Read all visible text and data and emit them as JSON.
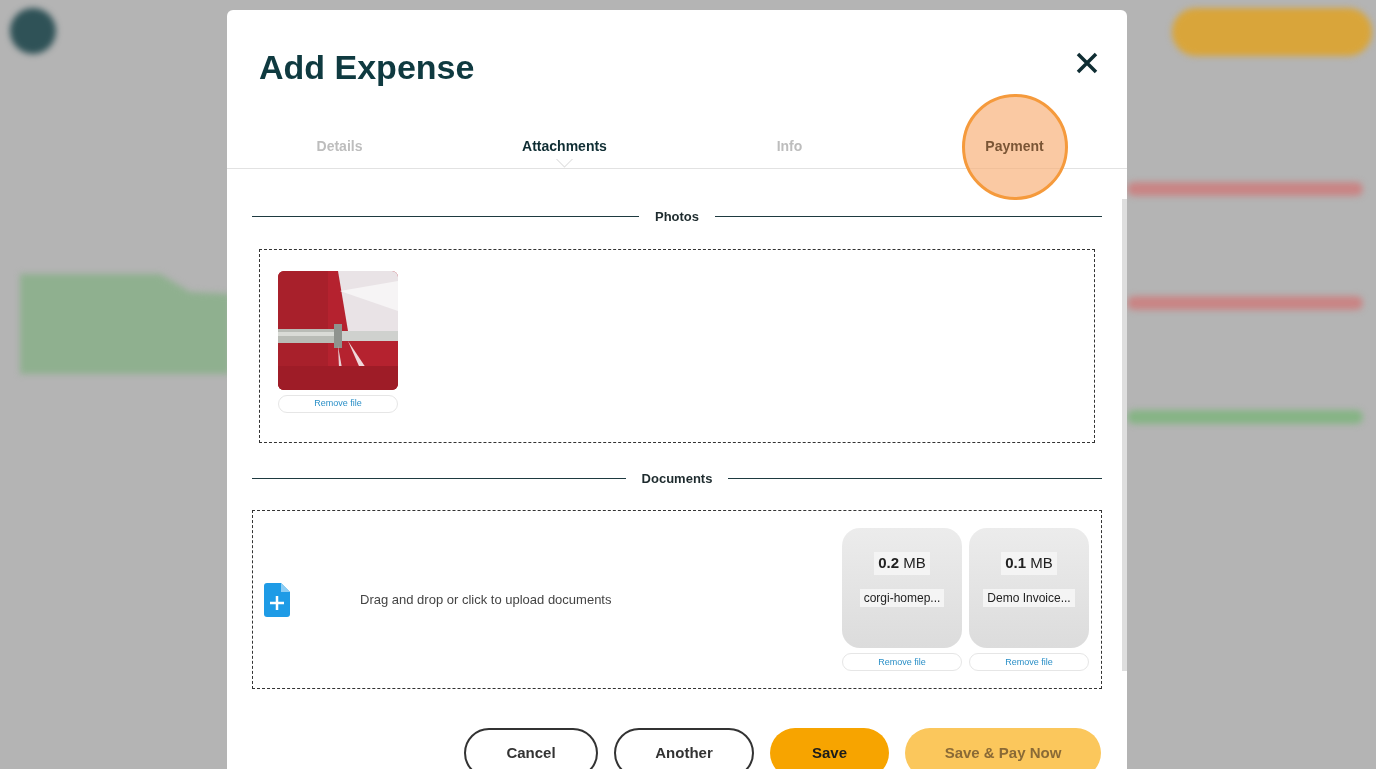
{
  "dialog": {
    "title": "Add Expense",
    "tabs": [
      {
        "label": "Details",
        "selected": false
      },
      {
        "label": "Attachments",
        "selected": true
      },
      {
        "label": "Info",
        "selected": false
      },
      {
        "label": "Payment",
        "selected": false,
        "highlighted": true
      }
    ],
    "photos": {
      "heading": "Photos",
      "files": [
        {
          "kind": "picture",
          "remove_label": "Remove file"
        }
      ]
    },
    "documents": {
      "heading": "Documents",
      "upload_prompt": "Drag and drop or click to upload documents",
      "files": [
        {
          "size": "0.2",
          "unit": "MB",
          "name": "corgi-homep...",
          "remove_label": "Remove file"
        },
        {
          "size": "0.1",
          "unit": "MB",
          "name": "Demo Invoice...",
          "remove_label": "Remove file"
        }
      ]
    },
    "buttons": [
      {
        "label": "Cancel",
        "kind": "outline",
        "disabled": false
      },
      {
        "label": "Another",
        "kind": "outline",
        "disabled": false
      },
      {
        "label": "Save",
        "kind": "primary",
        "disabled": false
      },
      {
        "label": "Save & Pay Now",
        "kind": "primary",
        "disabled": true
      }
    ]
  }
}
